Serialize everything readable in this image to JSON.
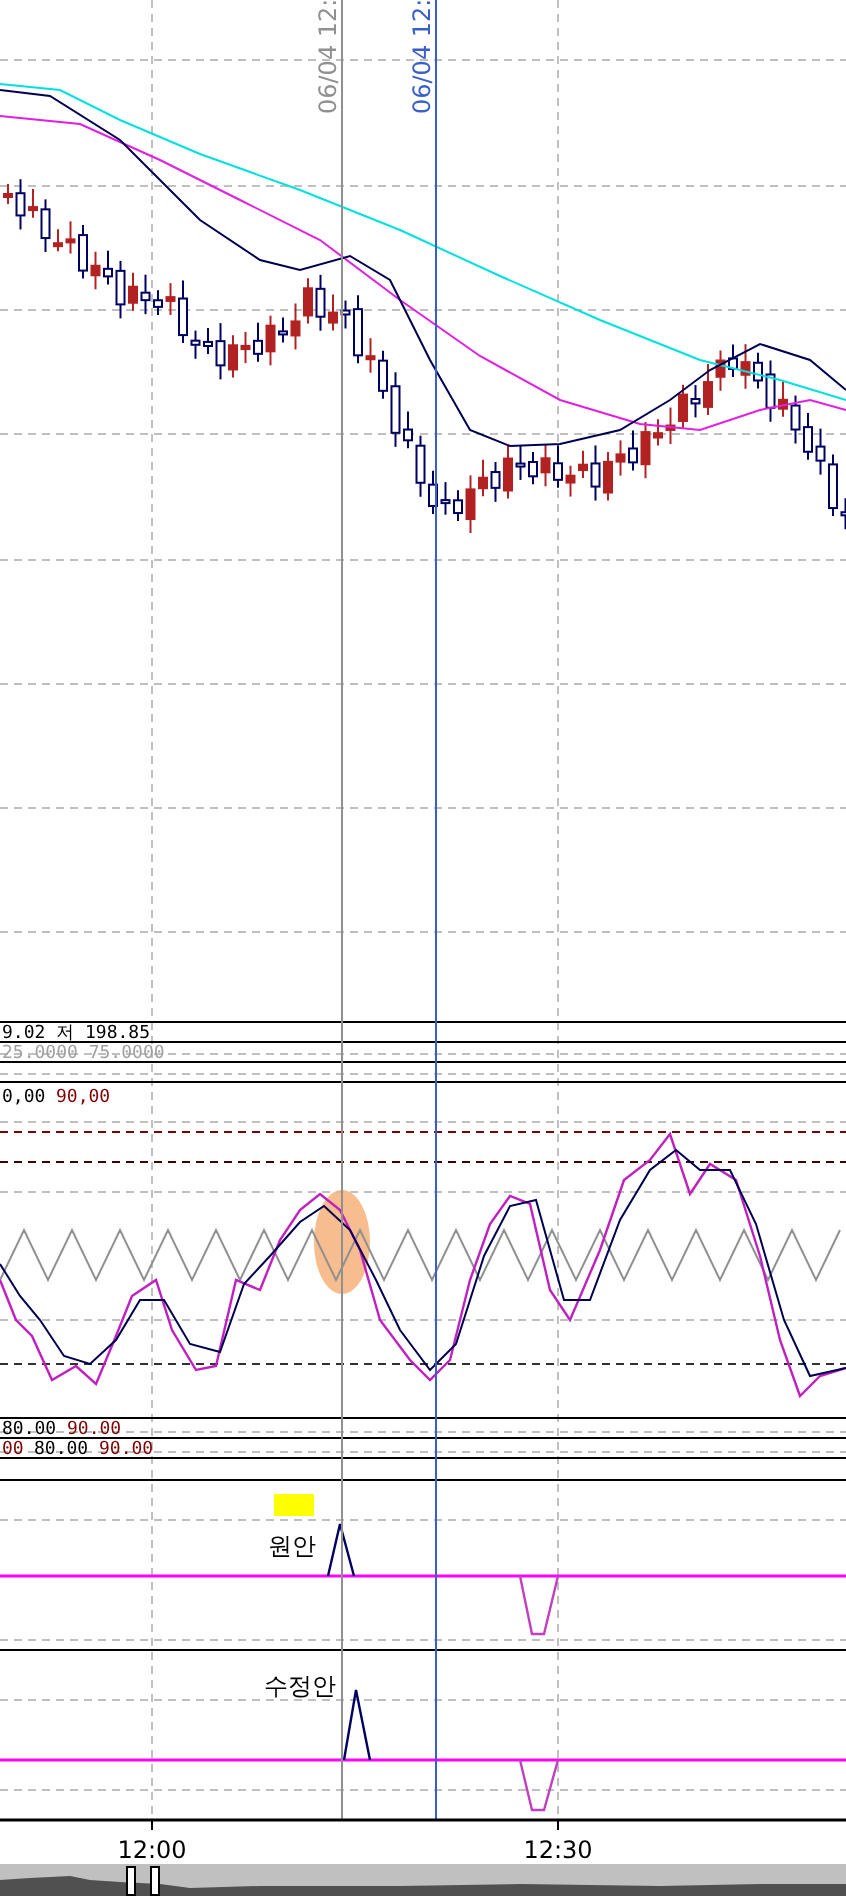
{
  "crosshairs": [
    {
      "label": "06/04 12:",
      "kind": "previous"
    },
    {
      "label": "06/04 12:",
      "kind": "current"
    }
  ],
  "legends": [
    {
      "parts": [
        {
          "text": "9.02 저 198.85",
          "color": "#000000"
        }
      ]
    },
    {
      "parts": [
        {
          "text": "25.0000 75.0000",
          "color": "#a0a0a0"
        }
      ]
    },
    {
      "parts": [
        {
          "text": "0,00",
          "color": "#000000"
        },
        {
          "text": "90,00",
          "color": "#800000"
        }
      ]
    },
    {
      "parts": [
        {
          "text": "80.00",
          "color": "#000000"
        },
        {
          "text": "90.00",
          "color": "#800000"
        }
      ]
    },
    {
      "parts": [
        {
          "text": "00",
          "color": "#800000"
        },
        {
          "text": "80.00",
          "color": "#000000"
        },
        {
          "text": "90.00",
          "color": "#800000"
        }
      ]
    }
  ],
  "signals": [
    {
      "label": "원안",
      "highlight": true
    },
    {
      "label": "수정안",
      "highlight": false
    }
  ],
  "time_axis": [
    "12:00",
    "12:30"
  ]
}
